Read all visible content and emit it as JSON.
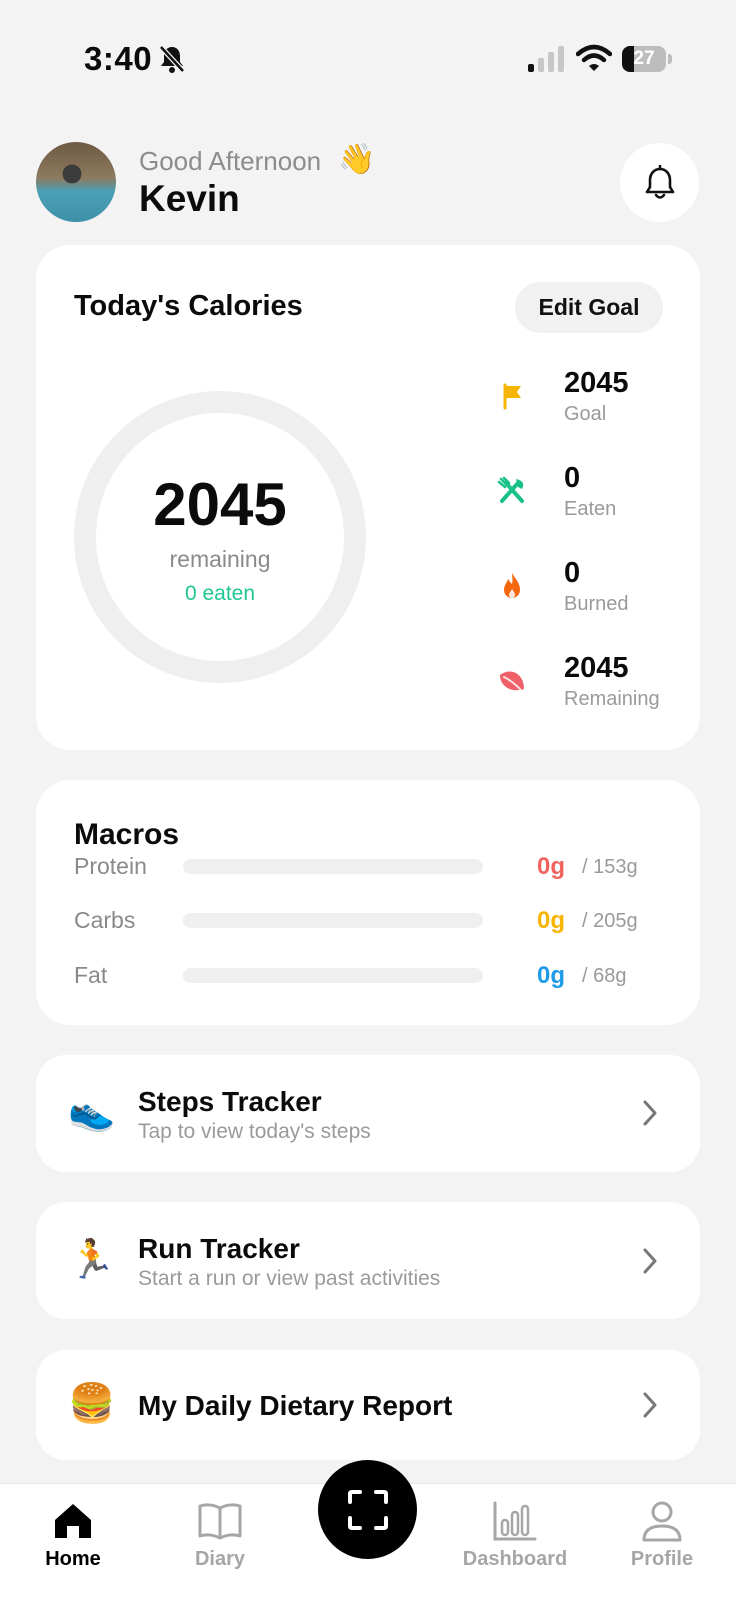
{
  "status_bar": {
    "time": "3:40",
    "battery": "27",
    "battery_level": 0.27
  },
  "header": {
    "greeting": "Good Afternoon",
    "wave_emoji": "👋",
    "username": "Kevin"
  },
  "calories": {
    "title": "Today's Calories",
    "edit_goal_label": "Edit Goal",
    "remaining_value": "2045",
    "remaining_label": "remaining",
    "eaten_text": "0 eaten",
    "progress": 0,
    "stats": [
      {
        "value": "2045",
        "label": "Goal",
        "icon": "flag-icon",
        "bg": "#fff3d9",
        "color": "#f5b400"
      },
      {
        "value": "0",
        "label": "Eaten",
        "icon": "utensils-icon",
        "bg": "#dcf7ee",
        "color": "#18c08a"
      },
      {
        "value": "0",
        "label": "Burned",
        "icon": "flame-icon",
        "bg": "#ffe8dc",
        "color": "#f5670f"
      },
      {
        "value": "2045",
        "label": "Remaining",
        "icon": "leaf-icon",
        "bg": "#ffe4e6",
        "color": "#ee5f67"
      }
    ]
  },
  "macros": {
    "title": "Macros",
    "items": [
      {
        "label": "Protein",
        "value": "0g",
        "target": "/ 153g",
        "fraction": 0,
        "color": "#f26360"
      },
      {
        "label": "Carbs",
        "value": "0g",
        "target": "/ 205g",
        "fraction": 0,
        "color": "#f7b500"
      },
      {
        "label": "Fat",
        "value": "0g",
        "target": "/ 68g",
        "fraction": 0,
        "color": "#1d9be8"
      }
    ]
  },
  "cards": [
    {
      "emoji": "👟",
      "title": "Steps Tracker",
      "subtitle": "Tap to view today's steps"
    },
    {
      "emoji": "🏃",
      "title": "Run Tracker",
      "subtitle": "Start a run or view past activities"
    },
    {
      "emoji": "🍔",
      "title": "My Daily Dietary Report",
      "subtitle": ""
    }
  ],
  "nav": {
    "items": [
      {
        "label": "Home",
        "icon": "home-icon",
        "active": true
      },
      {
        "label": "Diary",
        "icon": "book-icon",
        "active": false
      },
      {
        "label": "Dashboard",
        "icon": "bar-chart-icon",
        "active": false
      },
      {
        "label": "Profile",
        "icon": "person-icon",
        "active": false
      }
    ],
    "center_icon": "scan-icon"
  }
}
